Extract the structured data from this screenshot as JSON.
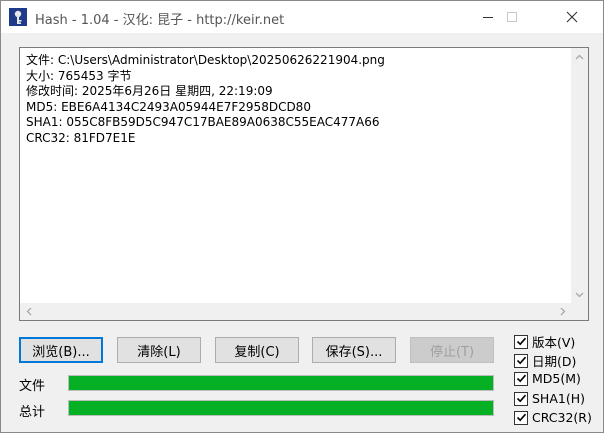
{
  "window": {
    "title": "Hash - 1.04 - 汉化: 昆子 - http://keir.net"
  },
  "output": {
    "lines": [
      "文件: C:\\Users\\Administrator\\Desktop\\20250626221904.png",
      "大小: 765453 字节",
      "修改时间: 2025年6月26日 星期四, 22:19:09",
      "MD5: EBE6A4134C2493A05944E7F2958DCD80",
      "SHA1: 055C8FB59D5C947C17BAE89A0638C55EAC477A66",
      "CRC32: 81FD7E1E"
    ]
  },
  "buttons": {
    "browse": "浏览(B)...",
    "clear": "清除(L)",
    "copy": "复制(C)",
    "save": "保存(S)...",
    "stop": "停止(T)"
  },
  "progress": {
    "file_label": "文件",
    "file_fraction": 1.0,
    "total_label": "总计",
    "total_fraction": 1.0
  },
  "options": [
    {
      "label": "版本(V)",
      "checked": true
    },
    {
      "label": "日期(D)",
      "checked": true
    },
    {
      "label": "MD5(M)",
      "checked": true
    },
    {
      "label": "SHA1(H)",
      "checked": true
    },
    {
      "label": "CRC32(R)",
      "checked": true
    }
  ],
  "icons": {
    "app": "key-icon",
    "minimize": "minimize-icon",
    "maximize": "maximize-icon",
    "close": "close-icon"
  },
  "colors": {
    "progress": "#06b025",
    "focus": "#0078d7"
  }
}
